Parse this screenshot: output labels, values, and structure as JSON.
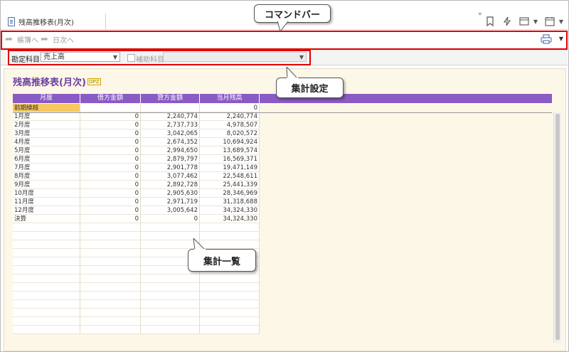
{
  "tab": {
    "title": "残高推移表(月次)"
  },
  "commands": {
    "ledger": "帳簿へ",
    "daily": "日次へ"
  },
  "settings": {
    "account_label": "勘定科目:",
    "account_value": "売上高",
    "sub_label": "補助科目",
    "sub_value": ""
  },
  "page": {
    "title": "残高推移表(月次)",
    "badge": "OPZ"
  },
  "grid": {
    "columns": [
      "月度",
      "借方金額",
      "貸方金額",
      "当月残高"
    ],
    "rows": [
      [
        "前期繰越",
        "",
        "",
        "0"
      ],
      [
        "1月度",
        "0",
        "2,240,774",
        "2,240,774"
      ],
      [
        "2月度",
        "0",
        "2,737,733",
        "4,978,507"
      ],
      [
        "3月度",
        "0",
        "3,042,065",
        "8,020,572"
      ],
      [
        "4月度",
        "0",
        "2,674,352",
        "10,694,924"
      ],
      [
        "5月度",
        "0",
        "2,994,650",
        "13,689,574"
      ],
      [
        "6月度",
        "0",
        "2,879,797",
        "16,569,371"
      ],
      [
        "7月度",
        "0",
        "2,901,778",
        "19,471,149"
      ],
      [
        "8月度",
        "0",
        "3,077,462",
        "22,548,611"
      ],
      [
        "9月度",
        "0",
        "2,892,728",
        "25,441,339"
      ],
      [
        "10月度",
        "0",
        "2,905,630",
        "28,346,969"
      ],
      [
        "11月度",
        "0",
        "2,971,719",
        "31,318,688"
      ],
      [
        "12月度",
        "0",
        "3,005,642",
        "34,324,330"
      ],
      [
        "決算",
        "0",
        "0",
        "34,324,330"
      ]
    ]
  },
  "annotations": {
    "command_bar": "コマンドバー",
    "settings": "集計設定",
    "list": "集計一覧"
  },
  "colors": {
    "header": "#8a5bc4",
    "title": "#6b3fa0",
    "highlight": "#f6c860",
    "annotation": "#e00000",
    "content_bg": "#fdf7e8"
  },
  "icons": [
    "document-icon",
    "bookmark-icon",
    "lightning-icon",
    "window-icon",
    "calendar-icon",
    "printer-icon",
    "arrow-right-icon"
  ]
}
